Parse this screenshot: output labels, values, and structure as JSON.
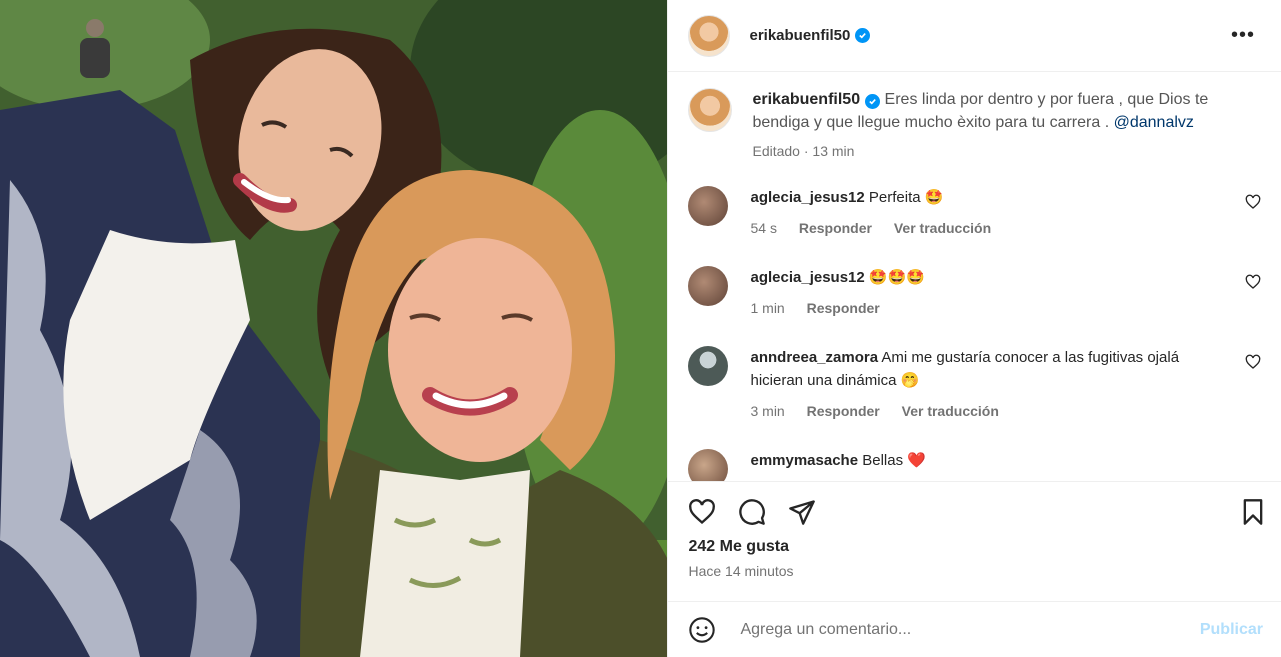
{
  "post": {
    "author": "erikabuenfil50",
    "caption": "Eres linda por dentro y por fuera , que Dios te bendiga y que llegue mucho èxito para tu carrera .",
    "mention": "@dannalvz",
    "caption_meta": "Editado · 13 min",
    "likes": "242 Me gusta",
    "timestamp": "Hace 14 minutos"
  },
  "comments": [
    {
      "user": "aglecia_jesus12",
      "text": "Perfeita 🤩",
      "time": "54 s",
      "reply": "Responder",
      "translate": "Ver traducción"
    },
    {
      "user": "aglecia_jesus12",
      "text": "🤩🤩🤩",
      "time": "1 min",
      "reply": "Responder"
    },
    {
      "user": "anndreea_zamora",
      "text": "Ami me gustaría conocer a las fugitivas ojalá hicieran una dinámica 🤭",
      "time": "3 min",
      "reply": "Responder",
      "translate": "Ver traducción"
    },
    {
      "user": "emmymasache",
      "text": "Bellas ❤️"
    }
  ],
  "composer": {
    "placeholder": "Agrega un comentario...",
    "publish_label": "Publicar"
  },
  "icons": {
    "more": "more-options-icon",
    "verified": "verified-badge-icon",
    "like": "heart-icon",
    "comment": "comment-icon",
    "share": "send-icon",
    "save": "bookmark-icon",
    "emoji": "emoji-icon"
  },
  "colors": {
    "verified": "#0095f6",
    "mention": "#00376b",
    "publish_disabled": "#b2dffc",
    "secondary_text": "#737373"
  }
}
